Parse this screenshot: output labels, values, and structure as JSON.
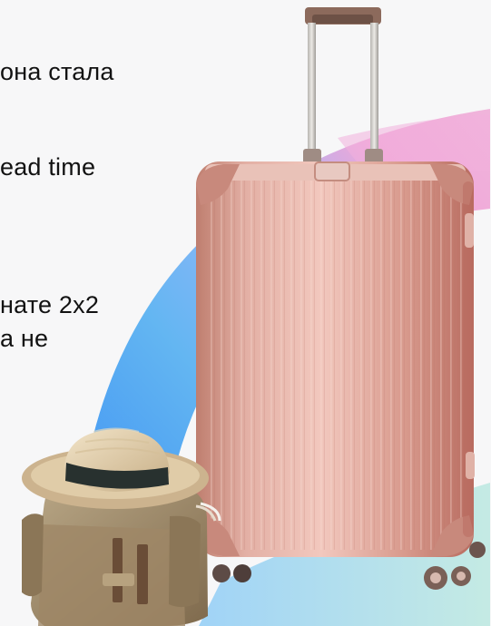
{
  "text_fragments": [
    "она стала",
    "ead time",
    "нате 2x2",
    "а не"
  ],
  "colors": {
    "background": "#f7f7f8",
    "text": "#121212",
    "arc_blue": "#3b8df5",
    "arc_pink": "#f4a6d8",
    "arc_teal": "#7fd3d0",
    "suitcase_rose_gold": "#d9a295",
    "hat_straw": "#d8c6a3",
    "bag_khaki": "#9a8563"
  },
  "icons": {
    "suitcase": "rose-gold-suitcase-illustration",
    "hat": "straw-hat-illustration",
    "bag": "canvas-bag-illustration",
    "arc": "gradient-arc-decoration"
  }
}
